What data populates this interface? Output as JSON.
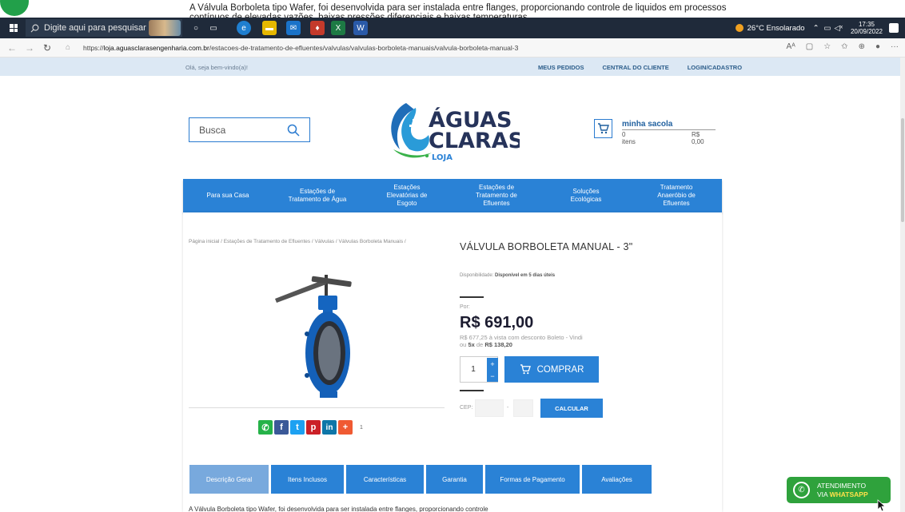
{
  "notification": {
    "text": "A Válvula Borboleta tipo Wafer, foi desenvolvida para ser instalada entre flanges, proporcionando controle de liquidos em processos contínuos de elevadas vazões, baixas pressões diferenciais e baixas temperaturas"
  },
  "taskbar": {
    "search_placeholder": "Digite aqui para pesquisar",
    "weather": "26°C Ensolarado",
    "time": "17:35",
    "date": "20/09/2022"
  },
  "browser": {
    "url_prefix": "https://",
    "url_domain": "loja.aguasclarasengenharia.com.br",
    "url_path": "/estacoes-de-tratamento-de-efluentes/valvulas/valvulas-borboleta-manuais/valvula-borboleta-manual-3"
  },
  "topbar": {
    "greeting": "Olá, seja bem-vindo(a)!",
    "links": [
      "MEUS PEDIDOS",
      "CENTRAL DO CLIENTE",
      "LOGIN/CADASTRO"
    ]
  },
  "header": {
    "search_placeholder": "Busca",
    "logo_line1": "ÁGUAS",
    "logo_line2": "CLARAS",
    "logo_line3": "LOJA",
    "cart_label": "minha sacola",
    "cart_items": "0 itens",
    "cart_total": "R$ 0,00"
  },
  "menu": [
    "Para sua Casa",
    "Estações de Tratamento de Água",
    "Estações Elevatórias de Esgoto",
    "Estações de Tratamento de Efluentes",
    "Soluções Ecológicas",
    "Tratamento Anaeróbio de Efluentes"
  ],
  "product": {
    "breadcrumb": "Página inicial / Estações de Tratamento de Efluentes / Válvulas / Válvulas Borboleta Manuais /",
    "title": "VÁLVULA BORBOLETA MANUAL - 3\"",
    "availability_label": "Disponibilidade:",
    "availability_value": "Disponível em 5 dias úteis",
    "price_prefix": "Por:",
    "price": "R$ 691,00",
    "discount_line1": "R$ 677,25 à vista com desconto Boleto - Vindi",
    "discount_line2_pre": "ou",
    "discount_installments": "5x",
    "discount_line2_mid": "de",
    "discount_installment_value": "R$ 138,20",
    "quantity": "1",
    "qty_plus": "+",
    "qty_minus": "−",
    "buy_label": "COMPRAR",
    "cep_label": "CEP:",
    "cep_separator": "-",
    "calc_label": "CALCULAR",
    "share_count": "1"
  },
  "share_icons": [
    {
      "icon": "whatsapp-icon",
      "glyph": "✆",
      "color": "#25b248"
    },
    {
      "icon": "facebook-icon",
      "glyph": "f",
      "color": "#3b5998"
    },
    {
      "icon": "twitter-icon",
      "glyph": "t",
      "color": "#1da1f2"
    },
    {
      "icon": "pinterest-icon",
      "glyph": "p",
      "color": "#cb2027"
    },
    {
      "icon": "linkedin-icon",
      "glyph": "in",
      "color": "#0e76a8"
    },
    {
      "icon": "more-share-icon",
      "glyph": "+",
      "color": "#f05a32"
    }
  ],
  "tabs": [
    "Descrição Geral",
    "Itens Inclusos",
    "Características",
    "Garantia",
    "Formas de Pagamento",
    "Avaliações"
  ],
  "body_text": "A Válvula Borboleta tipo Wafer, foi desenvolvida para ser instalada entre flanges, proporcionando controle",
  "whatsapp": {
    "line1": "ATENDIMENTO",
    "line2_pre": "VIA",
    "line2_highlight": "WHATSAPP"
  },
  "colors": {
    "brand_blue": "#2a82d6",
    "topbar_bg": "#dce8f4",
    "whatsapp_green": "#2fa23c",
    "tab_active": "#78a9dd"
  }
}
